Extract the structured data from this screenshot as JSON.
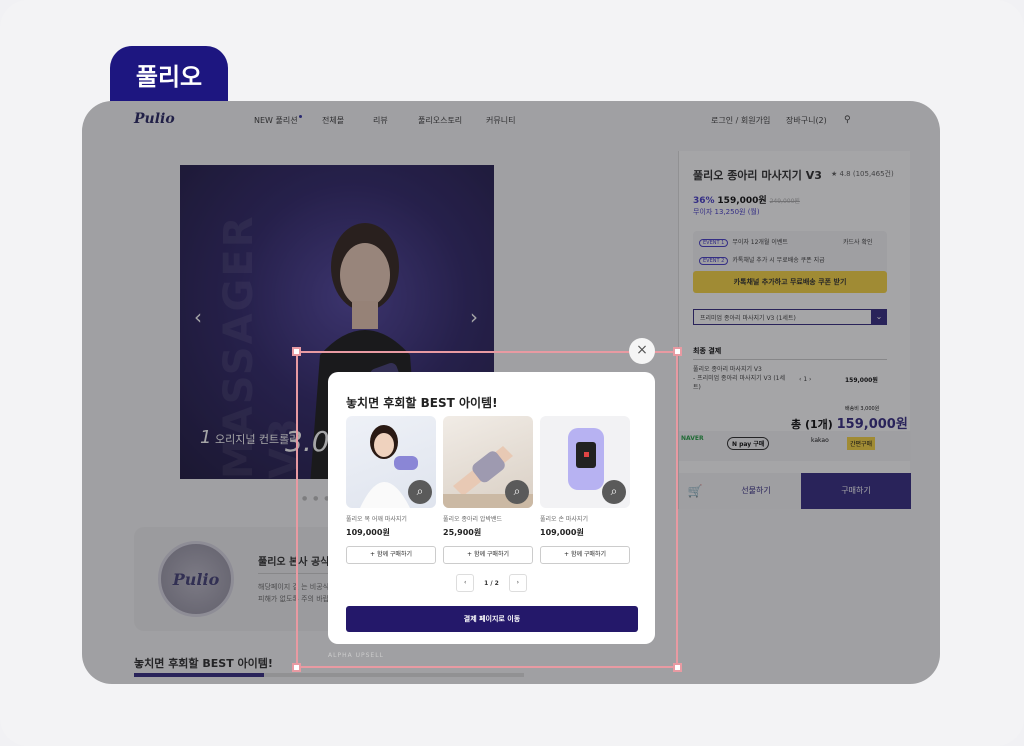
{
  "tag": "풀리오",
  "nav": {
    "logo": "Pulio",
    "items": [
      "NEW 풀리션",
      "전체몰",
      "리뷰",
      "풀리오스토리",
      "커뮤니티"
    ],
    "login": "로그인 / 회원가입",
    "cart": "장바구니(2)"
  },
  "hero": {
    "vertical_text": "MASSAGER V3",
    "sub_num": "1",
    "sub_label": "오리지널 컨트롤러",
    "big": "3.0"
  },
  "auth": {
    "seal": "Pulio",
    "title": "풀리오 본사 공식 판",
    "desc1": "해당페이지 결 는 비공식 판",
    "desc2": "피해가 없도록 주의 바랍니"
  },
  "best_section": "놓치면 후회할 BEST 아이템!",
  "panel": {
    "name": "풀리오 종아리 마사지기 V3",
    "rating": "★ 4.8 (105,465건)",
    "discount": "36%",
    "price": "159,000원",
    "old_price": "249,000원",
    "installment": "무이자  13,250원 (월)",
    "event1_tag": "EVENT 1",
    "event1": "무이자 12개월 이벤트",
    "event1_link": "카드사 확인",
    "event2_tag": "EVENT 2",
    "event2": "카톡채널 추가 시 무료배송 쿠폰 지급",
    "kakao_btn": "카톡채널 추가하고 무료배송 쿠폰 받기",
    "select": "프리미엄 종아리 마사지기 V3 (1세트)",
    "final": "최종 결제",
    "item_line1": "풀리오 종아리 마사지기 V3",
    "item_line2": "- 프리미엄 종아리 마사지기 V3 (1세",
    "item_line3": "트)",
    "qty": "1",
    "item_price": "159,000원",
    "shipping": "배송비 3,000원",
    "total_label": "총 (1개)",
    "total": "159,000원",
    "naver": "NAVER",
    "naver_pay": "N pay 구매",
    "kakao_pay": "kakao",
    "kakao_quick": "간편구매",
    "gift": "선물하기",
    "buy": "구매하기"
  },
  "modal": {
    "title": "놓치면 후회할 BEST 아이템!",
    "products": [
      {
        "name": "풀리오 목 어깨 마사지기",
        "price": "109,000원",
        "btn": "+ 함께 구매하기"
      },
      {
        "name": "풀리오 종아리 압박밴드",
        "price": "25,900원",
        "btn": "+ 함께 구매하기"
      },
      {
        "name": "풀리오 손 마사지기",
        "price": "109,000원",
        "btn": "+ 함께 구매하기"
      }
    ],
    "page": "1 / 2",
    "cta": "결제 페이지로 이동",
    "brand": "ALPHA UPSELL"
  }
}
